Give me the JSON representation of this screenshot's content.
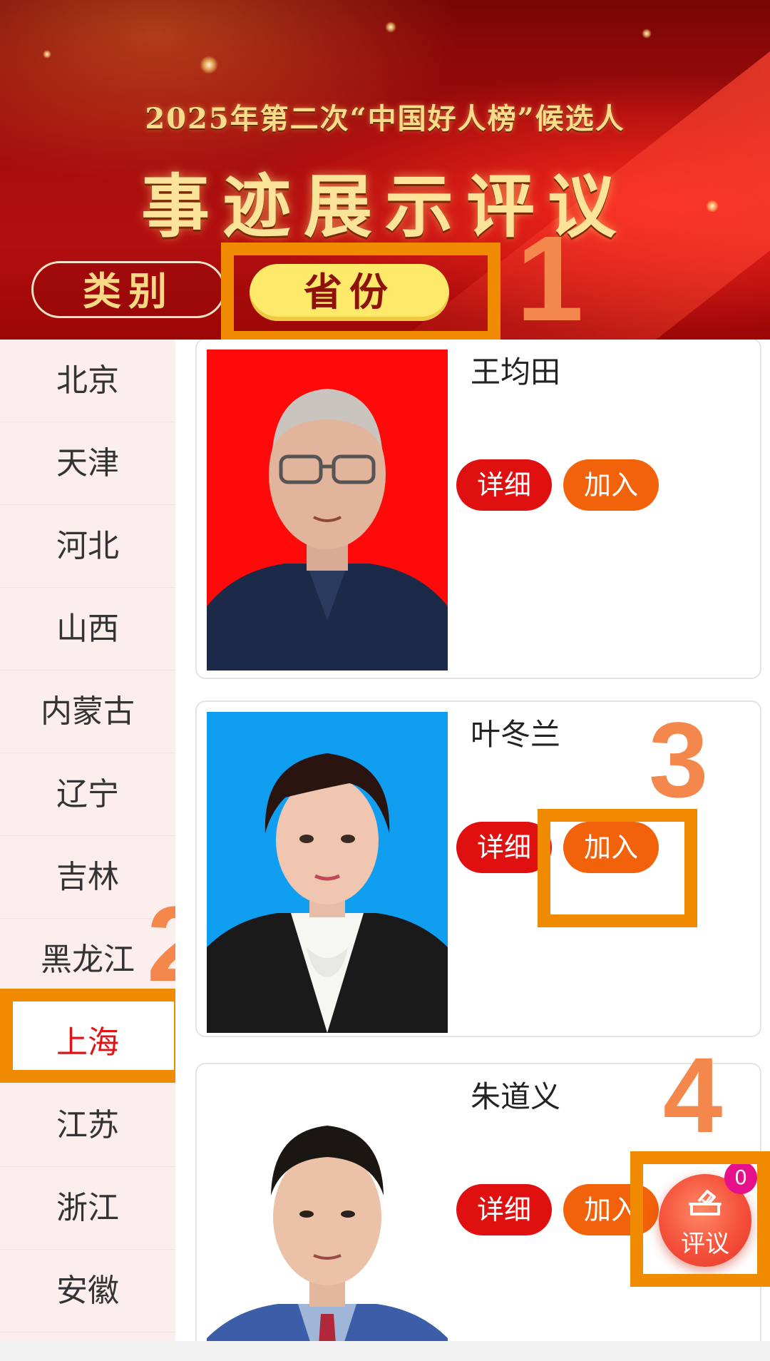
{
  "banner": {
    "subtitle": "2025年第二次“中国好人榜”候选人",
    "title": "事迹展示评议"
  },
  "tabs": {
    "category": "类别",
    "province": "省份"
  },
  "annotations": [
    "1",
    "2",
    "3",
    "4"
  ],
  "sidebar": {
    "active": "上海",
    "items": [
      "北京",
      "天津",
      "河北",
      "山西",
      "内蒙古",
      "辽宁",
      "吉林",
      "黑龙江",
      "上海",
      "江苏",
      "浙江",
      "安徽"
    ]
  },
  "candidates": [
    {
      "name": "王均田",
      "detail_label": "详细",
      "join_label": "加入",
      "photo_bg": "#ff0a0a"
    },
    {
      "name": "叶冬兰",
      "detail_label": "详细",
      "join_label": "加入",
      "photo_bg": "#0f9ef0"
    },
    {
      "name": "朱道义",
      "detail_label": "详细",
      "join_label": "加入",
      "photo_bg": "#ffffff"
    }
  ],
  "floating_button": {
    "label": "评议",
    "badge_count": "0",
    "icon": "ballot-box-icon"
  },
  "colors": {
    "accent_red": "#e01010",
    "join_orange": "#f2620b",
    "annotation_orange": "#f08a00"
  }
}
